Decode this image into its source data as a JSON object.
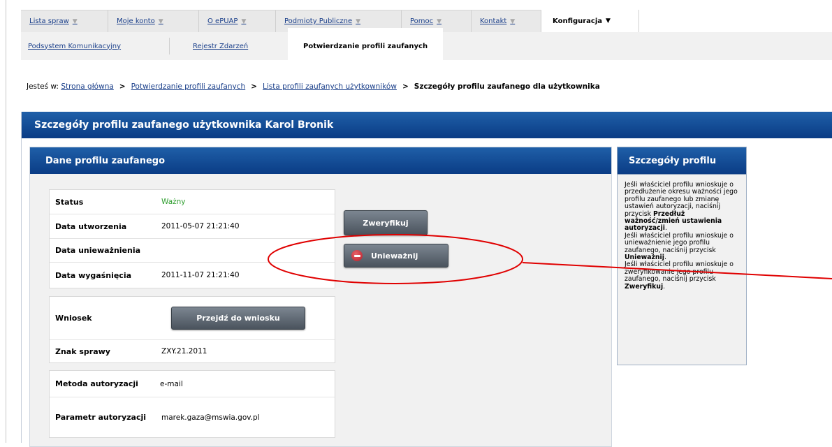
{
  "nav": {
    "tabs": [
      {
        "label": "Lista spraw",
        "caret": "▼"
      },
      {
        "label": "Moje konto",
        "caret": "▼"
      },
      {
        "label": "O ePUAP",
        "caret": "▼"
      },
      {
        "label": "Podmioty Publiczne",
        "caret": "▼"
      },
      {
        "label": "Pomoc",
        "caret": "▼"
      },
      {
        "label": "Kontakt",
        "caret": "▼"
      },
      {
        "label": "Konfiguracja",
        "caret": "▼"
      }
    ],
    "subtabs": [
      {
        "label": "Podsystem Komunikacyjny"
      },
      {
        "label": "Rejestr Zdarzeń"
      },
      {
        "label": "Potwierdzanie profili zaufanych"
      }
    ]
  },
  "breadcrumb": {
    "prefix": "Jesteś w:",
    "items": [
      "Strona główna",
      "Potwierdzanie profili zaufanych",
      "Lista profili zaufanych użytkowników"
    ],
    "current": "Szczegóły profilu zaufanego dla użytkownika",
    "separator": ">"
  },
  "page": {
    "title": "Szczegóły profilu zaufanego użytkownika Karol Bronik"
  },
  "profile": {
    "heading": "Dane profilu zaufanego",
    "status_label": "Status",
    "status_value": "Ważny",
    "created_label": "Data utworzenia",
    "created_value": "2011-05-07 21:21:40",
    "invalidated_label": "Data unieważnienia",
    "invalidated_value": "",
    "expires_label": "Data wygaśnięcia",
    "expires_value": "2011-11-07 21:21:40",
    "application_label": "Wniosek",
    "application_button": "Przejdź do wniosku",
    "case_label": "Znak sprawy",
    "case_value": "ZXY.21.2011",
    "auth_method_label": "Metoda autoryzacji",
    "auth_method_value": "e-mail",
    "auth_param_label": "Parametr autoryzacji",
    "auth_param_value": "marek.gaza@mswia.gov.pl"
  },
  "actions": {
    "verify": "Zweryfikuj",
    "invalidate": "Unieważnij",
    "invalidate_icon": "minus-circle-icon"
  },
  "details": {
    "heading": "Szczegóły profilu",
    "p1_a": "Jeśli właściciel profilu wnioskuje o przedłużenie okresu ważności jego profilu zaufanego lub zmianę ustawień autoryzacji, naciśnij przycisk ",
    "p1_b": "Przedłuż ważność/zmień ustawienia autoryzacji",
    "p1_c": ".",
    "p2_a": "Jeśli właściciel profilu wnioskuje o unieważnienie jego profilu zaufanego, naciśnij przycisk ",
    "p2_b": "Unieważnij",
    "p2_c": ".",
    "p3_a": "Jeśli właściciel profilu wnioskuje o zweryfikowanie jego profilu zaufanego, naciśnij przycisk ",
    "p3_b": "Zweryfikuj",
    "p3_c": "."
  },
  "colors": {
    "header_blue": "#0a3c85",
    "status_green": "#2e9e2e",
    "annotation_red": "#e00000"
  }
}
